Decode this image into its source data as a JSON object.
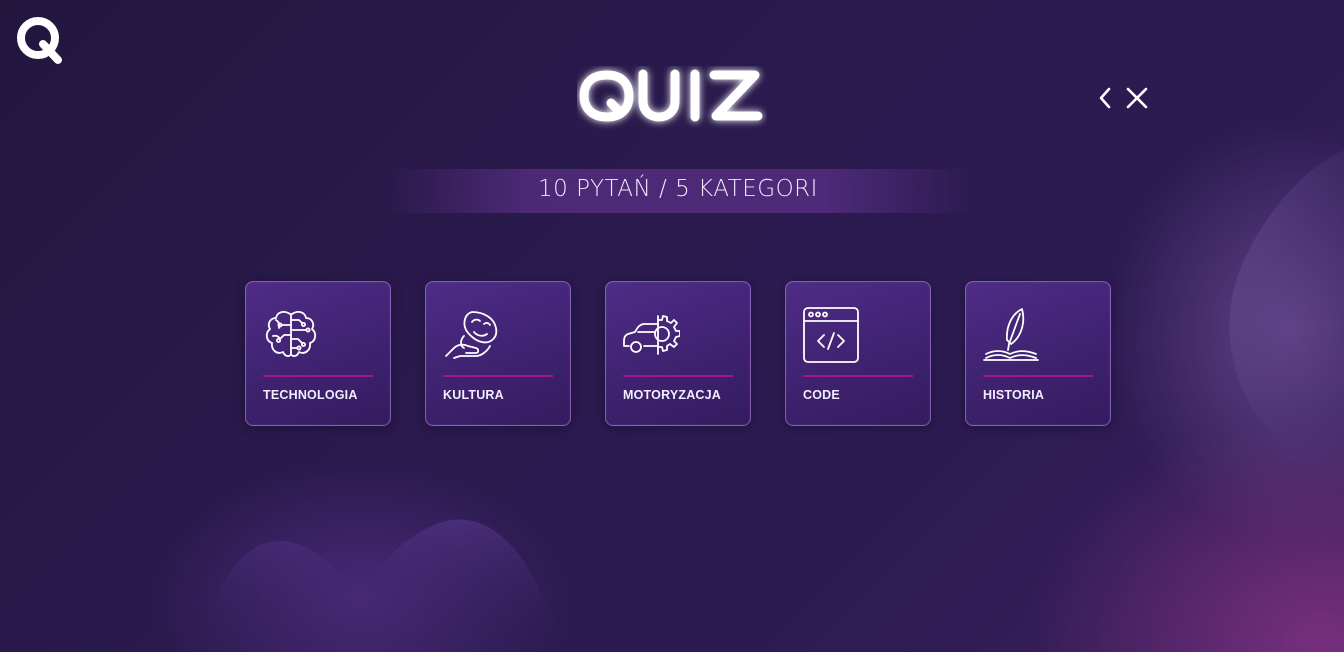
{
  "app": {
    "title": "QUIZ",
    "subtitle": "10 PYTAŃ / 5 KATEGORI"
  },
  "nav": {
    "back_icon": "chevron-left-icon",
    "close_icon": "close-icon"
  },
  "categories": [
    {
      "label": "TECHNOLOGIA",
      "icon": "brain-circuit-icon"
    },
    {
      "label": "KULTURA",
      "icon": "theater-mask-hand-icon"
    },
    {
      "label": "MOTORYZACJA",
      "icon": "car-gear-icon"
    },
    {
      "label": "CODE",
      "icon": "code-window-icon"
    },
    {
      "label": "HISTORIA",
      "icon": "quill-book-icon"
    }
  ],
  "colors": {
    "background": "#2a1a4d",
    "card": "#4a2a80",
    "accent_line": "#a4148f"
  }
}
